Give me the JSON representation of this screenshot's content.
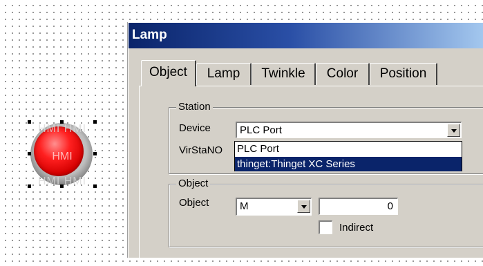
{
  "canvas": {
    "lamp": {
      "center_text": "HMI",
      "top_text": "HMI HMI",
      "bottom_text": "HMI HMI"
    }
  },
  "dialog": {
    "title": "Lamp",
    "tabs": [
      {
        "label": "Object",
        "active": true
      },
      {
        "label": "Lamp"
      },
      {
        "label": "Twinkle"
      },
      {
        "label": "Color"
      },
      {
        "label": "Position"
      }
    ],
    "station": {
      "group_label": "Station",
      "device_label": "Device",
      "device_value": "PLC Port",
      "virsta_label": "VirStaNO",
      "dropdown_options": [
        "PLC Port",
        "thinget:Thinget XC Series"
      ],
      "highlighted_option": "thinget:Thinget XC Series"
    },
    "object": {
      "group_label": "Object",
      "object_label": "Object",
      "object_type": "M",
      "object_address": "0",
      "indirect_label": "Indirect",
      "indirect_checked": false
    }
  },
  "colors": {
    "title_gradient_start": "#0a246a",
    "title_gradient_end": "#a6caf0",
    "dialog_face": "#d4d0c8",
    "selection": "#0a246a",
    "lamp_red": "#ff2020"
  }
}
